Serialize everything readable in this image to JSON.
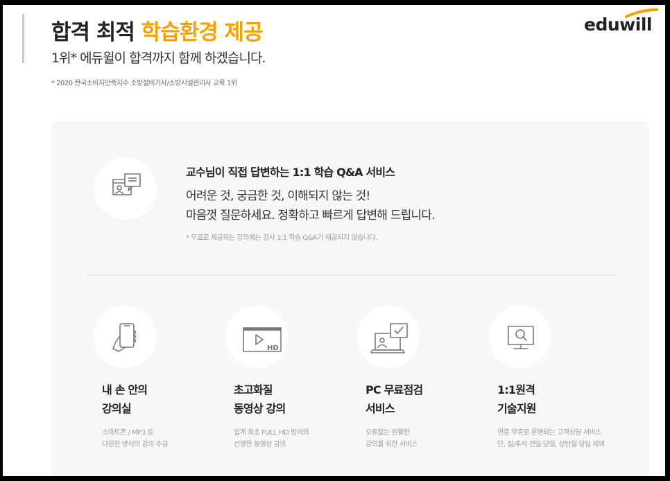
{
  "header": {
    "title_prefix": "합격 최적 ",
    "title_highlight": "학습환경 제공",
    "subtitle": "1위* 에듀윌이 합격까지 함께 하겠습니다.",
    "footnote": "* 2020 한국소비자만족지수 소방설비기사/소방시설관리사 교육 1위",
    "logo_text": "eduwill",
    "accent_color": "#f5a000"
  },
  "qa": {
    "icon": "qa-chat-icon",
    "title": "교수님이 직접 답변하는 1:1 학습 Q&A 서비스",
    "line1": "어려운 것, 궁금한 것, 이해되지 않는 것!",
    "line2": "마음껏 질문하세요. 정확하고 빠르게 답변해 드립니다.",
    "note": "* 무료로 제공되는 강의에는 강사 1:1 학습 Q&A가 제공되지 않습니다."
  },
  "features": [
    {
      "icon": "smartphone-hand-icon",
      "title1": "내 손 안의",
      "title2": "강의실",
      "desc1": "스마트폰 / MP3 등",
      "desc2": "다양한 방식의 강의 수강"
    },
    {
      "icon": "hd-video-icon",
      "title1": "초고화질",
      "title2": "동영상 강의",
      "desc1": "업계 최초 FULL HD 방식의",
      "desc2": "선명한 동영상 강의"
    },
    {
      "icon": "pc-check-icon",
      "title1": "PC 무료점검",
      "title2": "서비스",
      "desc1": "오류없는 원활한",
      "desc2": "강의를 위한 서비스"
    },
    {
      "icon": "remote-support-icon",
      "title1": "1:1원격",
      "title2": "기술지원",
      "desc1": "연중 무휴로 운영되는 고객상담 서비스",
      "desc2": "단, 설/추석 전일·당일, 성탄절 당일 제외"
    }
  ]
}
